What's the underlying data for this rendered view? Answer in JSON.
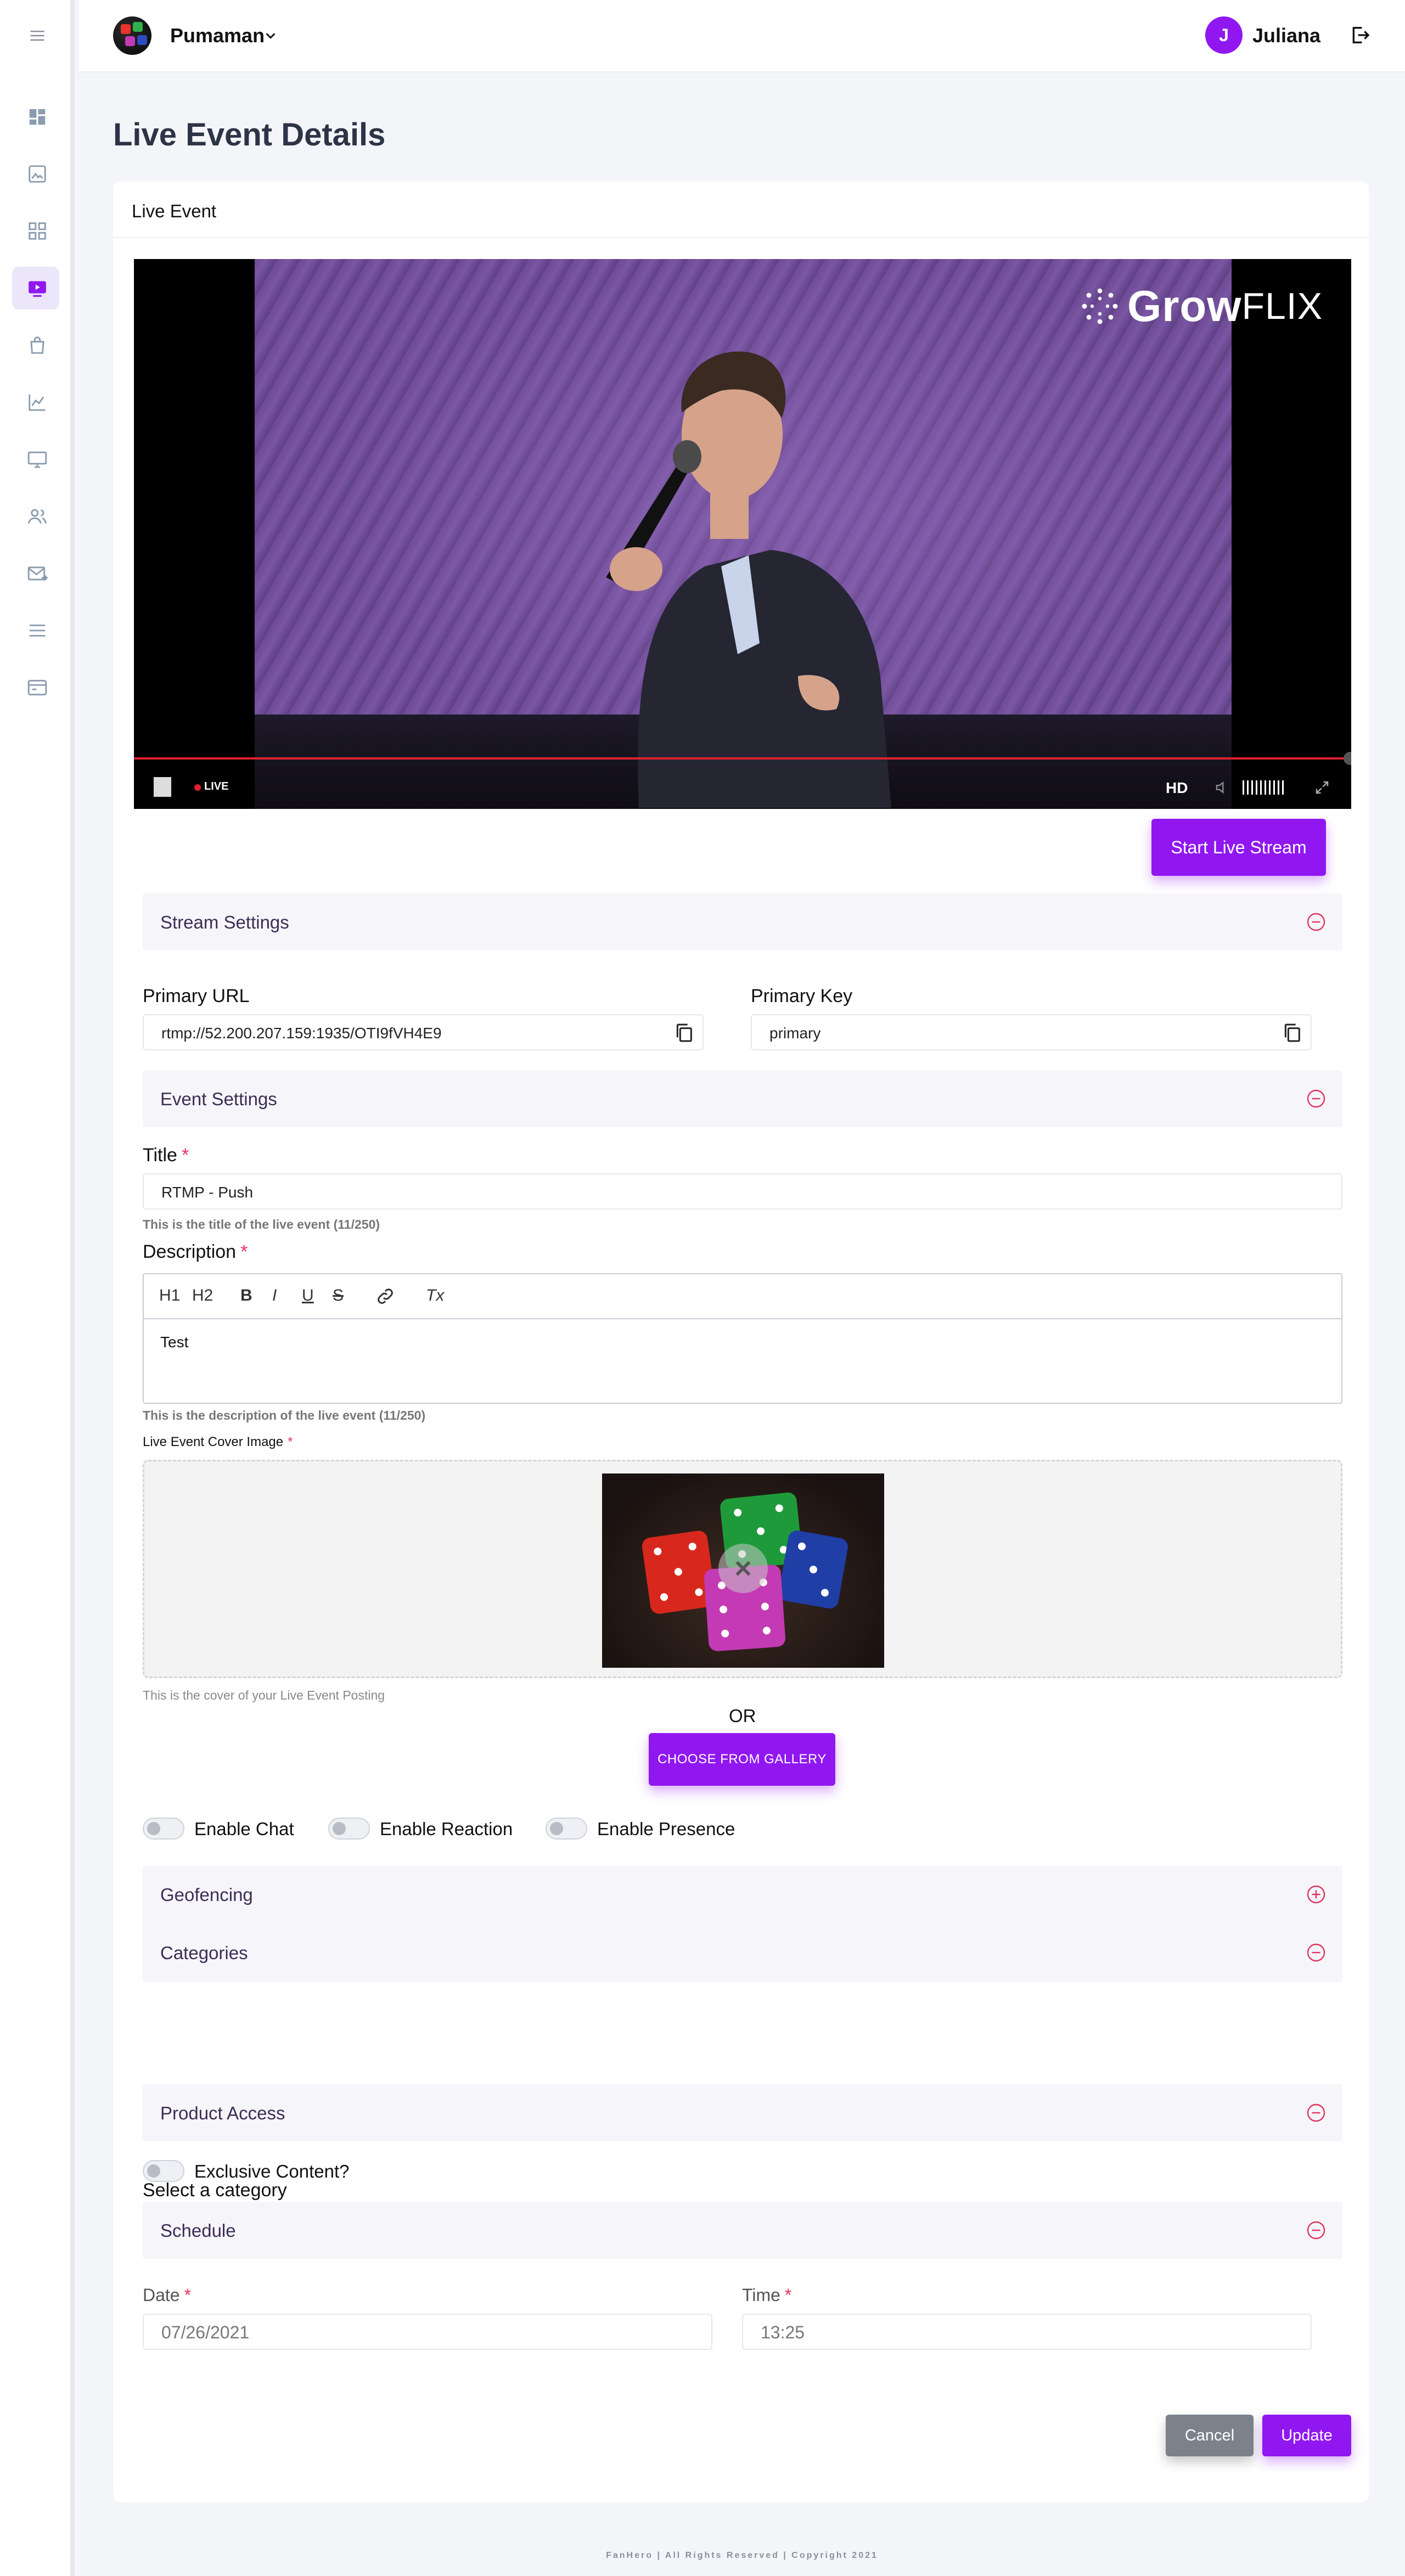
{
  "header": {
    "brand_name": "Pumaman",
    "user_initial": "J",
    "user_name": "Juliana"
  },
  "sidebar": {
    "items": [
      {
        "icon": "menu-icon"
      },
      {
        "icon": "dashboard-icon"
      },
      {
        "icon": "image-icon"
      },
      {
        "icon": "grid-icon"
      },
      {
        "icon": "live-video-icon",
        "active": true
      },
      {
        "icon": "shopping-bag-icon"
      },
      {
        "icon": "chart-line-icon"
      },
      {
        "icon": "monitor-icon"
      },
      {
        "icon": "users-icon"
      },
      {
        "icon": "mail-icon"
      },
      {
        "icon": "list-icon"
      },
      {
        "icon": "card-icon"
      }
    ]
  },
  "page": {
    "title": "Live Event Details",
    "card_header": "Live Event"
  },
  "video": {
    "brand_bold": "Grow",
    "brand_light": "FLIX",
    "live_label": "LIVE",
    "quality_label": "HD"
  },
  "actions": {
    "start_stream": "Start Live Stream",
    "cancel": "Cancel",
    "update": "Update",
    "gallery": "CHOOSE FROM GALLERY",
    "or": "OR"
  },
  "sections": {
    "stream_settings": "Stream Settings",
    "event_settings": "Event Settings",
    "geofencing": "Geofencing",
    "categories": "Categories",
    "product_access": "Product Access",
    "schedule": "Schedule"
  },
  "stream": {
    "primary_url_label": "Primary URL",
    "primary_url_value": "rtmp://52.200.207.159:1935/OTI9fVH4E9",
    "primary_key_label": "Primary Key",
    "primary_key_value": "primary"
  },
  "event": {
    "title_label": "Title",
    "title_value": "RTMP - Push",
    "title_help": "This is the title of the live event (11/250)",
    "description_label": "Description",
    "description_value": "Test",
    "description_help": "This is the description of the live event (11/250)",
    "cover_label": "Live Event Cover Image",
    "cover_help": "This is the cover of your Live Event Posting",
    "required_mark": "*"
  },
  "editor_toolbar": {
    "h1": "H1",
    "h2": "H2",
    "bold": "B",
    "italic": "I",
    "underline": "U",
    "strike": "S",
    "clear": "Tx"
  },
  "toggles": {
    "chat": "Enable Chat",
    "reaction": "Enable Reaction",
    "presence": "Enable Presence",
    "exclusive": "Exclusive Content?"
  },
  "category": {
    "label": "Select a category",
    "selected": ""
  },
  "schedule": {
    "date_label": "Date",
    "date_value": "07/26/2021",
    "time_label": "Time",
    "time_value": "13:25"
  },
  "footer": {
    "text": "FanHero | All Rights Reserved | Copyright 2021"
  },
  "colors": {
    "accent": "#9117f0",
    "section_text": "#3d2d55",
    "required": "#e0355f"
  }
}
